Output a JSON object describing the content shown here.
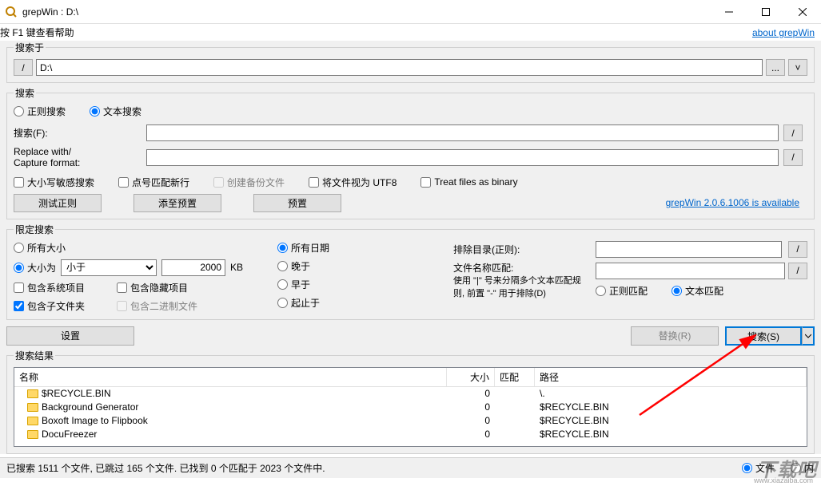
{
  "titlebar": {
    "app": "grepWin",
    "path": "D:\\"
  },
  "help_hint": "按 F1 键查看帮助",
  "about_link": "about grepWin",
  "search_in": {
    "legend": "搜索于",
    "path": "D:\\",
    "browse": "...",
    "recent": "˅"
  },
  "search": {
    "legend": "搜索",
    "regex": "正则搜索",
    "text": "文本搜索",
    "search_for": "搜索(F):",
    "replace_with": "Replace with/\nCapture format:",
    "case_sensitive": "大小写敏感搜索",
    "dot_newline": "点号匹配新行",
    "create_backup": "创建备份文件",
    "utf8": "将文件视为 UTF8",
    "binary": "Treat files as binary",
    "test_regex": "测试正则",
    "add_preset": "添至预置",
    "presets": "预置",
    "update_link": "grepWin 2.0.6.1006 is available"
  },
  "limit": {
    "legend": "限定搜索",
    "all_sizes": "所有大小",
    "size_is": "大小为",
    "size_op": "小于",
    "size_val": "2000",
    "size_unit": "KB",
    "include_system": "包含系统项目",
    "include_hidden": "包含隐藏项目",
    "include_subfolders": "包含子文件夹",
    "include_binary": "包含二进制文件",
    "all_dates": "所有日期",
    "newer_than": "晚于",
    "older_than": "早于",
    "between": "起止于",
    "exclude_dirs": "排除目录(正则):",
    "filename_match": "文件名称匹配:",
    "filename_hint": "使用 \"|\" 号来分隔多个文本匹配规则, 前置 \"-\" 用于排除(D)",
    "regex_match": "正则匹配",
    "text_match": "文本匹配"
  },
  "actions": {
    "settings": "设置",
    "replace": "替换(R)",
    "search": "搜索(S)"
  },
  "results": {
    "legend": "搜索结果",
    "cols": {
      "name": "名称",
      "size": "大小",
      "match": "匹配",
      "path": "路径"
    },
    "rows": [
      {
        "name": "$RECYCLE.BIN",
        "size": "0",
        "match": "",
        "path": "\\."
      },
      {
        "name": "Background Generator",
        "size": "0",
        "match": "",
        "path": "$RECYCLE.BIN"
      },
      {
        "name": "Boxoft Image to Flipbook",
        "size": "0",
        "match": "",
        "path": "$RECYCLE.BIN"
      },
      {
        "name": "DocuFreezer",
        "size": "0",
        "match": "",
        "path": "$RECYCLE.BIN"
      }
    ]
  },
  "status": {
    "text": "已搜索 1511 个文件, 已跳过 165 个文件. 已找到 0 个匹配于 2023 个文件中.",
    "file_radio": "文件",
    "content_radio": "内"
  },
  "watermark": "下载吧",
  "watermark_url": "www.xiazaiba.com"
}
